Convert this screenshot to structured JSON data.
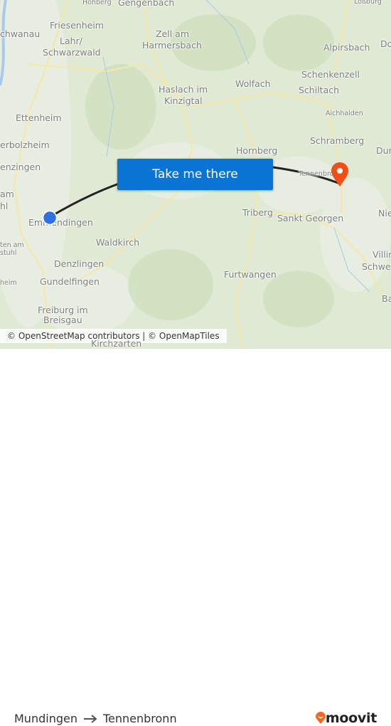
{
  "map": {
    "labels": [
      "Hohberg",
      "Gengenbach",
      "Friesenheim",
      "chwanau",
      "Lahr/",
      "Schwarzwald",
      "Zell am",
      "Harmersbach",
      "Alpirsbach",
      "Do",
      "Schenkenzell",
      "Schiltach",
      "Wolfach",
      "Haslach im",
      "Kinzigtal",
      "Aichhalden",
      "Ettenheim",
      "Schramberg",
      "Dur",
      "erbolzheim",
      "Hornberg",
      "enzingen",
      "Tennenbronn",
      "am",
      "hl",
      "Triberg",
      "Sankt Georgen",
      "Nie",
      "Emmendingen",
      "Waldkirch",
      "ten am",
      "stuhl",
      "Villin",
      "Schwen",
      "Denzlingen",
      "Gundelfingen",
      "heim",
      "Furtwangen",
      "Freiburg im",
      "Breisgau",
      "Ba",
      "Loßburg",
      "Kirchzarten"
    ],
    "origin_color": "#2f6fe4",
    "destination_color": "#f04f17",
    "route_color": "#222222",
    "origin_icon": "origin-dot-icon",
    "destination_icon": "map-pin-icon"
  },
  "cta": {
    "label": "Take me there",
    "color": "#0a74d4"
  },
  "attribution": "© OpenStreetMap contributors | © OpenMapTiles",
  "route": {
    "from": "Mundingen",
    "to": "Tennenbronn",
    "arrow_icon": "arrow-right-icon"
  },
  "brand": {
    "name": "moovit",
    "color": "#f26a21"
  }
}
